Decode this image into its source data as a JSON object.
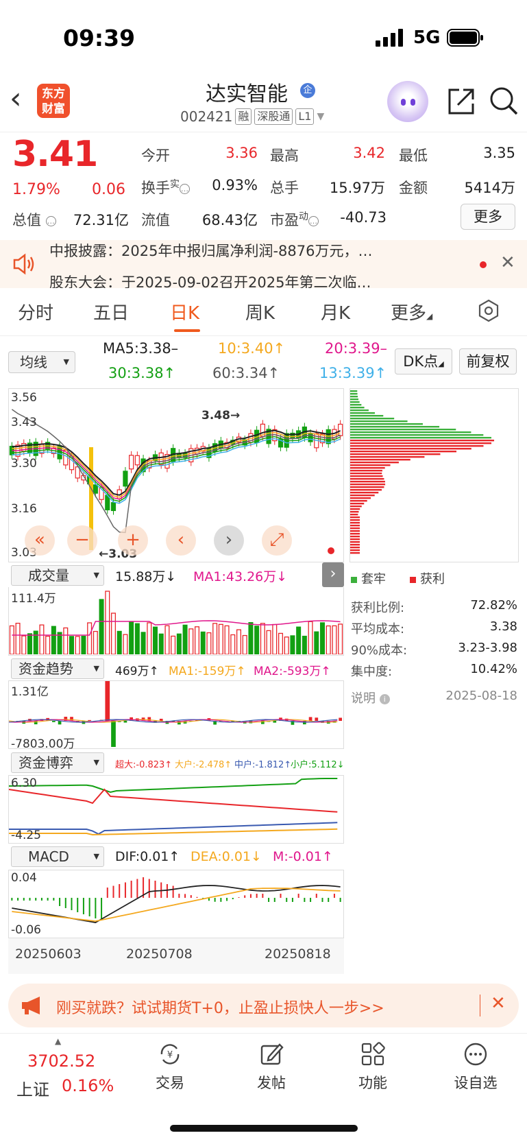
{
  "status": {
    "time": "09:39",
    "network": "5G"
  },
  "header": {
    "logo": "东方\n财富",
    "stock_name": "达实智能",
    "ent_badge": "企",
    "code": "002421",
    "tags": [
      "融",
      "深股通",
      "L1"
    ]
  },
  "quote": {
    "price": "3.41",
    "change_pct": "1.79%",
    "change_amt": "0.06",
    "fields": [
      {
        "label": "今开",
        "value": "3.36"
      },
      {
        "label": "最高",
        "value": "3.42"
      },
      {
        "label": "最低",
        "value": "3.35"
      },
      {
        "label": "换手",
        "sup": "实",
        "value": "0.93%"
      },
      {
        "label": "总手",
        "value": "15.97万"
      },
      {
        "label": "金额",
        "value": "5414万"
      },
      {
        "label": "总值",
        "value": "72.31亿"
      },
      {
        "label": "流值",
        "value": "68.43亿"
      },
      {
        "label": "市盈",
        "sup": "动",
        "value": "-40.73"
      }
    ],
    "more_label": "更多"
  },
  "notice": {
    "line1": "中报披露：2025年中报归属净利润-8876万元，…",
    "line2": "股东大会：于2025-09-02召开2025年第二次临…"
  },
  "tabs": [
    "分时",
    "五日",
    "日K",
    "周K",
    "月K",
    "更多"
  ],
  "active_tab": "日K",
  "ma": {
    "select": "均线",
    "ma5": "MA5:3.38–",
    "ma10": "10:3.40↑",
    "ma20": "20:3.39–",
    "ma30": "30:3.38↑",
    "ma60": "60:3.34↑",
    "ma13": "13:3.39↑",
    "dk_label": "DK点",
    "fq_label": "前复权"
  },
  "kline": {
    "y_labels": [
      "3.56",
      "3.43",
      "3.30",
      "3.16",
      "3.03"
    ],
    "high_mark": "3.48→",
    "low_mark": "←3.03"
  },
  "volume": {
    "select": "成交量",
    "value": "15.88万↓",
    "ma1": "MA1:43.26万↓",
    "max_label": "111.4万"
  },
  "fund_trend": {
    "select": "资金趋势",
    "value": "469万↑",
    "ma1": "MA1:-159万↑",
    "ma2": "MA2:-593万↑",
    "max_label": "1.31亿",
    "min_label": "-7803.00万"
  },
  "fund_game": {
    "select": "资金博弈",
    "super": "超大:-0.823↑",
    "large": "大户:-2.478↑",
    "mid": "中户:-1.812↑",
    "small": "小户:5.112↓",
    "max_label": "6.30",
    "min_label": "-4.25"
  },
  "macd": {
    "select": "MACD",
    "dif": "DIF:0.01↑",
    "dea": "DEA:0.01↓",
    "m": "M:-0.01↑",
    "max_label": "0.04",
    "min_label": "-0.06",
    "dates": [
      "20250603",
      "20250708",
      "20250818"
    ]
  },
  "chip": {
    "legend_trap": "套牢",
    "legend_profit": "获利",
    "stats": [
      {
        "label": "获利比例:",
        "value": "72.82%"
      },
      {
        "label": "平均成本:",
        "value": "3.38"
      },
      {
        "label": "90%成本:",
        "value": "3.23-3.98"
      },
      {
        "label": "集中度:",
        "value": "10.42%"
      }
    ],
    "note_label": "说明",
    "note_date": "2025-08-18"
  },
  "ad": {
    "text": "刚买就跌？试试期货T+0，止盈止损快人一步>>"
  },
  "bottom": {
    "index_value": "3702.52",
    "index_name": "上证",
    "index_pct": "0.16%",
    "items": [
      "交易",
      "发帖",
      "功能",
      "设自选"
    ]
  },
  "colors": {
    "up": "#e8262a",
    "down": "#12a012",
    "accent": "#f05a1e"
  }
}
